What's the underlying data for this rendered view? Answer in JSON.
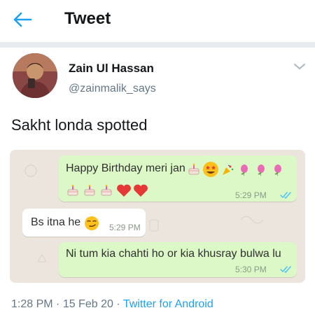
{
  "header": {
    "title": "Tweet",
    "back_icon": "arrow-left-icon",
    "accent": "#1da1f2"
  },
  "author": {
    "name": "Zain Ul Hassan",
    "handle": "@zainmalik_says"
  },
  "tweet": {
    "text": "Sakht londa spotted"
  },
  "chat": {
    "messages": [
      {
        "direction": "out",
        "text": "Happy Birthday meri jan",
        "time": "5:29 PM",
        "read": true,
        "emoji": [
          "birthday-cake",
          "star-struck-face",
          "party-popper",
          "balloon",
          "balloon",
          "balloon",
          "birthday-cake",
          "birthday-cake",
          "birthday-cake",
          "red-heart",
          "red-heart"
        ]
      },
      {
        "direction": "in",
        "text": "Bs itna he",
        "time": "5:29 PM",
        "emoji": [
          "smirking-face"
        ]
      },
      {
        "direction": "out",
        "text": "Ni tum kia chahti ho or kia khusray bulwa lu",
        "time": "5:30 PM",
        "read": true
      }
    ],
    "colors": {
      "outgoing": "#dcf8c6",
      "incoming": "#ffffff",
      "background": "#ece5dd",
      "ticks": "#4fc3f7"
    }
  },
  "footer": {
    "time": "1:28 PM",
    "sep1": " · ",
    "date": "15 Feb 20",
    "sep2": " · ",
    "source": "Twitter for Android"
  }
}
